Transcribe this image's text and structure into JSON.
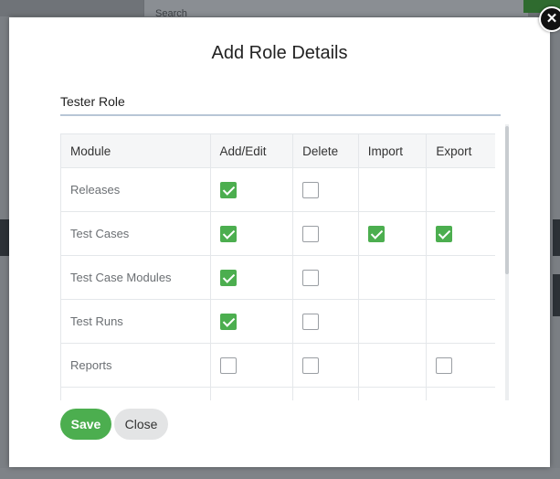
{
  "background": {
    "search_placeholder": "Search"
  },
  "modal": {
    "title": "Add Role Details",
    "role_name": "Tester Role",
    "close_icon": "close-icon",
    "columns": [
      "Module",
      "Add/Edit",
      "Delete",
      "Import",
      "Export"
    ],
    "rows": [
      {
        "module": "Releases",
        "add_edit": true,
        "delete": false,
        "import": null,
        "export": null
      },
      {
        "module": "Test Cases",
        "add_edit": true,
        "delete": false,
        "import": true,
        "export": true
      },
      {
        "module": "Test Case Modules",
        "add_edit": true,
        "delete": false,
        "import": null,
        "export": null
      },
      {
        "module": "Test Runs",
        "add_edit": true,
        "delete": false,
        "import": null,
        "export": null
      },
      {
        "module": "Reports",
        "add_edit": false,
        "delete": false,
        "import": null,
        "export": false
      }
    ],
    "save_label": "Save",
    "close_label": "Close",
    "accent_color": "#4cae4f"
  }
}
